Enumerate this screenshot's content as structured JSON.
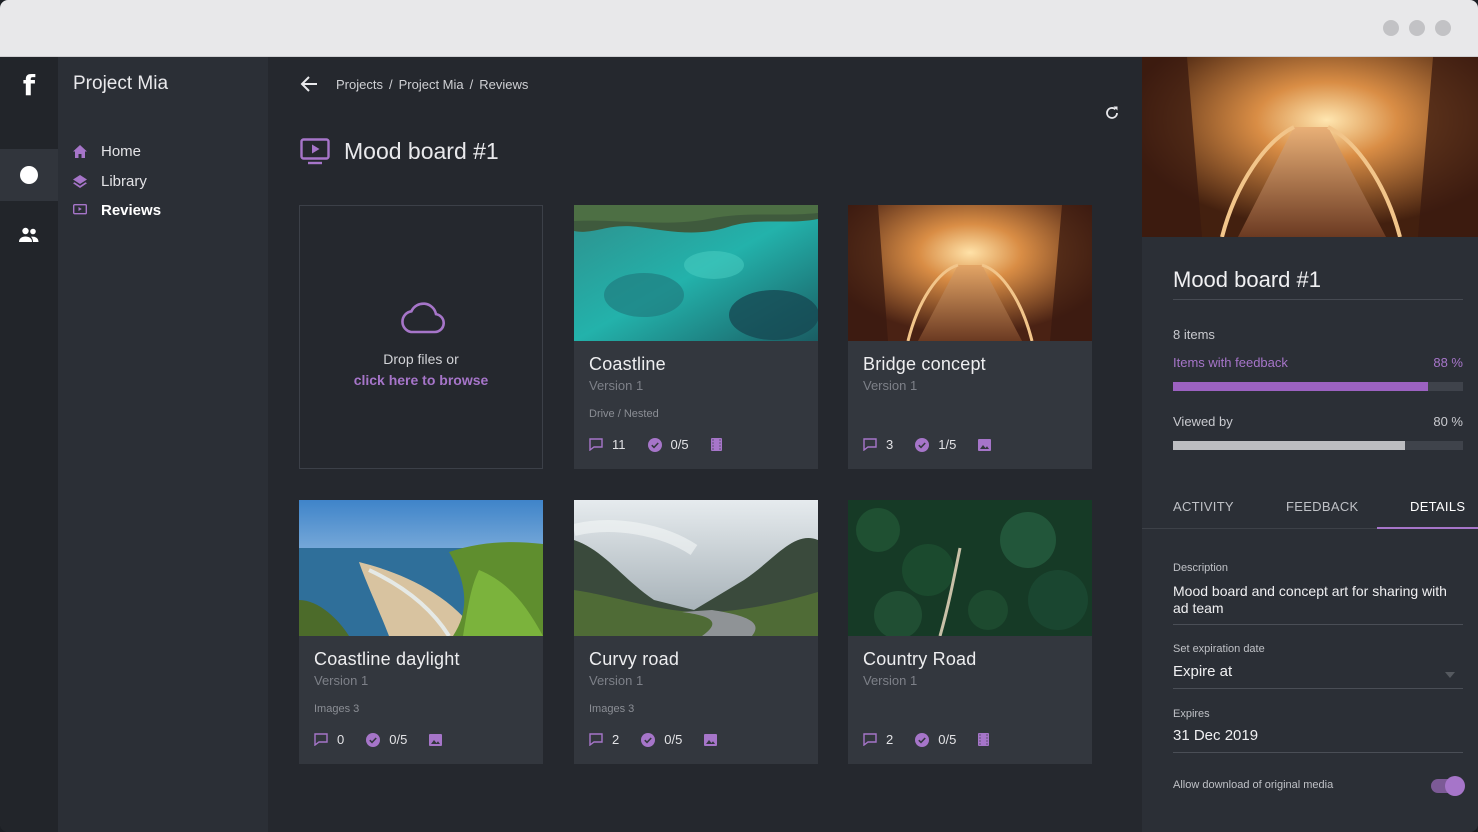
{
  "window": {
    "controls": [
      "minimize",
      "maximize",
      "close"
    ]
  },
  "rail": {
    "logo": "f",
    "items": [
      {
        "icon": "circle-icon",
        "active": true
      },
      {
        "icon": "people-icon",
        "active": false
      }
    ]
  },
  "sidebar": {
    "project": "Project Mia",
    "items": [
      {
        "label": "Home",
        "icon": "home-icon",
        "active": false
      },
      {
        "label": "Library",
        "icon": "layers-icon",
        "active": false
      },
      {
        "label": "Reviews",
        "icon": "monitor-play-icon",
        "active": true
      }
    ]
  },
  "header": {
    "breadcrumb": [
      "Projects",
      "Project Mia",
      "Reviews"
    ],
    "separator": "/",
    "title": "Mood board #1"
  },
  "dropzone": {
    "line1": "Drop files or",
    "line2": "click here to browse"
  },
  "cards": [
    {
      "title": "Coastline",
      "version": "Version 1",
      "meta": "Drive / Nested",
      "comments": "11",
      "approvals": "0/5",
      "type_icon": "film-icon",
      "thumb": "ocean"
    },
    {
      "title": "Bridge concept",
      "version": "Version 1",
      "meta": "",
      "comments": "3",
      "approvals": "1/5",
      "type_icon": "image-icon",
      "thumb": "bridge"
    },
    {
      "title": "Coastline daylight",
      "version": "Version 1",
      "meta": "Images 3",
      "comments": "0",
      "approvals": "0/5",
      "type_icon": "image-icon",
      "thumb": "beach"
    },
    {
      "title": "Curvy road",
      "version": "Version 1",
      "meta": "Images 3",
      "comments": "2",
      "approvals": "0/5",
      "type_icon": "image-icon",
      "thumb": "road"
    },
    {
      "title": "Country Road",
      "version": "Version 1",
      "meta": "",
      "comments": "2",
      "approvals": "0/5",
      "type_icon": "film-icon",
      "thumb": "forest"
    }
  ],
  "panel": {
    "title": "Mood board #1",
    "items_count": "8 items",
    "feedback_label": "Items with feedback",
    "feedback_pct": "88 %",
    "feedback_value": 0.88,
    "viewed_label": "Viewed by",
    "viewed_pct": "80 %",
    "viewed_value": 0.8,
    "tabs": [
      "ACTIVITY",
      "FEEDBACK",
      "DETAILS"
    ],
    "active_tab": "DETAILS",
    "description_label": "Description",
    "description": "Mood board and concept art for sharing with ad team",
    "expiration_label": "Set expiration date",
    "expiration_value": "Expire at",
    "expires_label": "Expires",
    "expires_value": "31 Dec 2019",
    "download_label": "Allow download of original media",
    "download_enabled": true
  },
  "colors": {
    "accent": "#a675c9",
    "bg_main": "#25282e",
    "card": "#33373e",
    "panel": "#2b2f36"
  }
}
